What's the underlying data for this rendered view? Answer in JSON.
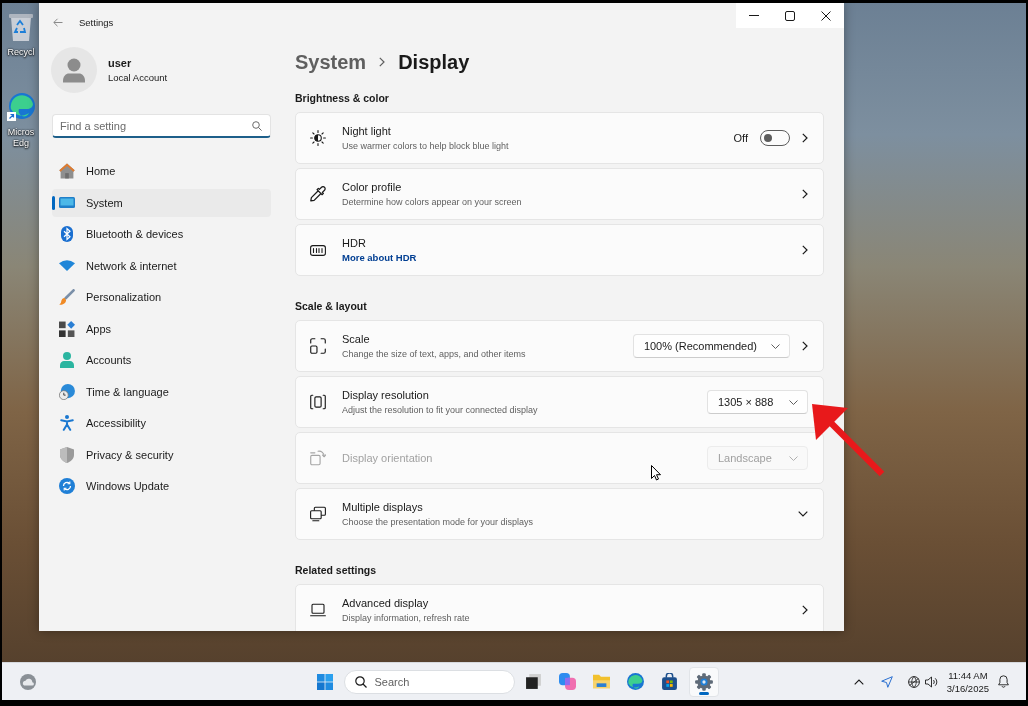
{
  "window": {
    "title": "Settings"
  },
  "profile": {
    "name": "user",
    "account_type": "Local Account"
  },
  "search": {
    "placeholder": "Find a setting"
  },
  "sidebar": {
    "items": [
      {
        "label": "Home",
        "selected": false
      },
      {
        "label": "System",
        "selected": true
      },
      {
        "label": "Bluetooth & devices",
        "selected": false
      },
      {
        "label": "Network & internet",
        "selected": false
      },
      {
        "label": "Personalization",
        "selected": false
      },
      {
        "label": "Apps",
        "selected": false
      },
      {
        "label": "Accounts",
        "selected": false
      },
      {
        "label": "Time & language",
        "selected": false
      },
      {
        "label": "Accessibility",
        "selected": false
      },
      {
        "label": "Privacy & security",
        "selected": false
      },
      {
        "label": "Windows Update",
        "selected": false
      }
    ]
  },
  "breadcrumb": [
    {
      "label": "System",
      "current": false
    },
    {
      "label": "Display",
      "current": true
    }
  ],
  "sections": [
    {
      "title": "Brightness & color",
      "settings": [
        {
          "title": "Night light",
          "description": "Use warmer colors to help block blue light",
          "kind": "link",
          "disabled": false,
          "toggle": {
            "label": "Off",
            "on": false
          }
        },
        {
          "title": "Color profile",
          "description": "Determine how colors appear on your screen",
          "kind": "link",
          "disabled": false
        },
        {
          "title": "HDR",
          "link": "More about HDR",
          "kind": "link",
          "disabled": false
        }
      ]
    },
    {
      "title": "Scale & layout",
      "settings": [
        {
          "title": "Scale",
          "description": "Change the size of text, apps, and other items",
          "kind": "link",
          "disabled": false,
          "dropdown": {
            "value": "100% (Recommended)"
          }
        },
        {
          "title": "Display resolution",
          "description": "Adjust the resolution to fit your connected display",
          "kind": "plain",
          "disabled": false,
          "dropdown": {
            "value": "1305 × 888"
          }
        },
        {
          "title": "Display orientation",
          "kind": "plain",
          "disabled": true,
          "dropdown": {
            "value": "Landscape"
          }
        },
        {
          "title": "Multiple displays",
          "description": "Choose the presentation mode for your displays",
          "kind": "expander",
          "disabled": false,
          "expanded": false
        }
      ]
    },
    {
      "title": "Related settings",
      "settings": [
        {
          "title": "Advanced display",
          "description": "Display information, refresh rate",
          "kind": "link",
          "disabled": false
        }
      ]
    }
  ],
  "desktop": {
    "icons": [
      {
        "label": "Recycl"
      },
      {
        "label": "Micros Edg"
      }
    ]
  },
  "taskbar": {
    "search": {
      "placeholder": "Search"
    },
    "apps": [
      {
        "selected": false
      },
      {
        "selected": false
      },
      {
        "selected": false
      },
      {
        "selected": false
      },
      {
        "selected": false
      },
      {
        "selected": true
      }
    ],
    "time": "11:44 AM",
    "date": "3/16/2025"
  },
  "annotations": [
    {
      "kind": "arrow"
    }
  ]
}
